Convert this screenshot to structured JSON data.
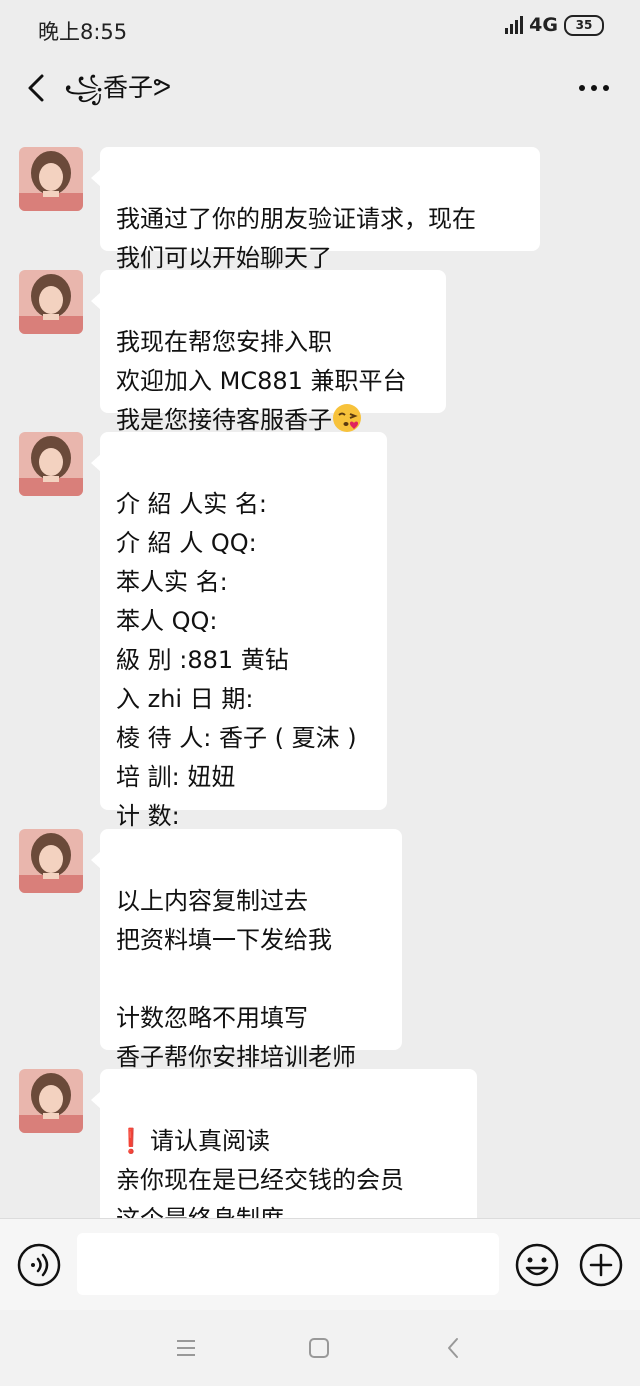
{
  "status_bar": {
    "time": "晚上8:55",
    "network": "4G",
    "battery": "35"
  },
  "nav": {
    "title": "꧁香子ᕗ"
  },
  "messages": [
    {
      "id": 1,
      "text": "我通过了你的朋友验证请求，现在\n我们可以开始聊天了"
    },
    {
      "id": 2,
      "text": "我现在帮您安排入职\n欢迎加入 MC881 兼职平台\n我是您接待客服香子",
      "emoji": "kissing-face-emoji"
    },
    {
      "id": 3,
      "text": "介 紹 人实 名:\n介 紹 人 QQ:\n苯人实 名:\n苯人 QQ:\n級 別 :881 黄钻\n入 zhi 日 期:\n棱 待 人: 香子 ( 夏沫 )\n培 訓: 妞妞\n计 数:"
    },
    {
      "id": 4,
      "text": "以上内容复制过去\n把资料填一下发给我\n\n计数忽略不用填写\n香子帮你安排培训老师"
    },
    {
      "id": 5,
      "warn": "❗",
      "text": "请认真阅读\n亲你现在是已经交钱的会员\n这个是终身制度\n以后不要再交一分钱"
    }
  ],
  "input": {
    "placeholder": ""
  },
  "icons": {
    "back": "back-arrow-icon",
    "more": "more-dots-icon",
    "voice": "voice-icon",
    "emoji": "emoji-icon",
    "plus": "plus-icon",
    "sys_menu": "menu-icon",
    "sys_home": "home-icon",
    "sys_back": "back-icon"
  },
  "colors": {
    "background": "#ededed",
    "bubble": "#ffffff",
    "warn": "#e02424"
  }
}
